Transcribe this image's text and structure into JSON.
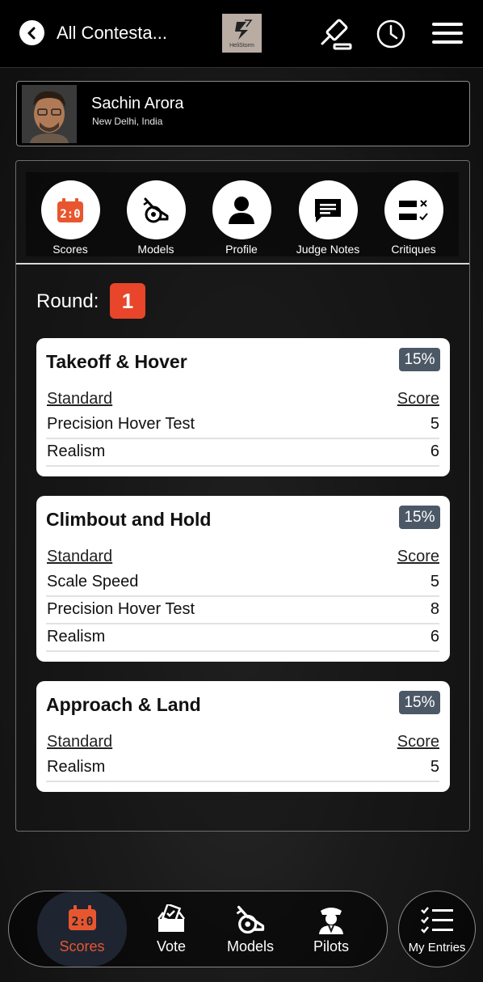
{
  "header": {
    "title": "All Contesta...",
    "logo_text": "HeliStorm",
    "icons": [
      "back-icon",
      "auction-gavel-icon",
      "clock-icon",
      "menu-icon"
    ]
  },
  "contestant": {
    "name": "Sachin Arora",
    "location": "New Delhi, India"
  },
  "tabs": [
    {
      "label": "Scores",
      "icon": "scoreboard-icon"
    },
    {
      "label": "Models",
      "icon": "helicopter-model-icon"
    },
    {
      "label": "Profile",
      "icon": "person-icon"
    },
    {
      "label": "Judge Notes",
      "icon": "notes-icon"
    },
    {
      "label": "Critiques",
      "icon": "checklist-icon"
    }
  ],
  "round": {
    "label": "Round:",
    "number": "1"
  },
  "sections": [
    {
      "title": "Takeoff & Hover",
      "weight": "15%",
      "header_standard": "Standard",
      "header_score": "Score",
      "rows": [
        {
          "standard": "Precision Hover Test",
          "score": "5"
        },
        {
          "standard": "Realism",
          "score": "6"
        }
      ]
    },
    {
      "title": "Climbout and Hold",
      "weight": "15%",
      "header_standard": "Standard",
      "header_score": "Score",
      "rows": [
        {
          "standard": "Scale Speed",
          "score": "5"
        },
        {
          "standard": "Precision Hover Test",
          "score": "8"
        },
        {
          "standard": "Realism",
          "score": "6"
        }
      ]
    },
    {
      "title": "Approach & Land",
      "weight": "15%",
      "header_standard": "Standard",
      "header_score": "Score",
      "rows": [
        {
          "standard": "Realism",
          "score": "5"
        }
      ]
    }
  ],
  "bottom_nav": [
    {
      "label": "Scores",
      "active": true
    },
    {
      "label": "Vote",
      "active": false
    },
    {
      "label": "Models",
      "active": false
    },
    {
      "label": "Pilots",
      "active": false
    }
  ],
  "my_entries": {
    "label": "My Entries"
  },
  "colors": {
    "accent": "#e8452a",
    "badge": "#4c5866",
    "background": "#1b1b1b"
  }
}
